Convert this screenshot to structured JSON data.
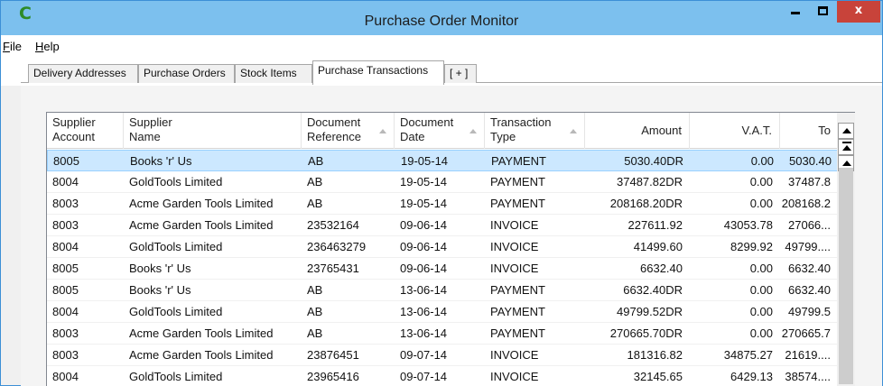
{
  "window": {
    "title": "Purchase Order Monitor",
    "app_icon": "C",
    "close_glyph": "x"
  },
  "menu": {
    "file": {
      "mnemonic": "F",
      "rest": "ile"
    },
    "help": {
      "mnemonic": "H",
      "rest": "elp"
    }
  },
  "tabs": [
    "Delivery Addresses",
    "Purchase Orders",
    "Stock Items",
    "Purchase Transactions",
    "[ + ]"
  ],
  "active_tab": "Purchase Transactions",
  "grid": {
    "columns": [
      {
        "line1": "Supplier",
        "line2": "Account"
      },
      {
        "line1": "Supplier",
        "line2": "Name"
      },
      {
        "line1": "Document",
        "line2": "Reference"
      },
      {
        "line1": "Document",
        "line2": "Date"
      },
      {
        "line1": "Transaction",
        "line2": "Type"
      },
      {
        "line1": "Amount",
        "line2": ""
      },
      {
        "line1": "V.A.T.",
        "line2": ""
      },
      {
        "line1": "To",
        "line2": ""
      }
    ],
    "rows": [
      [
        "8005",
        "Books 'r' Us",
        "AB",
        "19-05-14",
        "PAYMENT",
        "5030.40DR",
        "0.00",
        "5030.40"
      ],
      [
        "8004",
        "GoldTools Limited",
        "AB",
        "19-05-14",
        "PAYMENT",
        "37487.82DR",
        "0.00",
        "37487.8"
      ],
      [
        "8003",
        "Acme Garden Tools Limited",
        "AB",
        "19-05-14",
        "PAYMENT",
        "208168.20DR",
        "0.00",
        "208168.2"
      ],
      [
        "8003",
        "Acme Garden Tools Limited",
        "23532164",
        "09-06-14",
        "INVOICE",
        "227611.92",
        "43053.78",
        "27066..."
      ],
      [
        "8004",
        "GoldTools Limited",
        "236463279",
        "09-06-14",
        "INVOICE",
        "41499.60",
        "8299.92",
        "49799...."
      ],
      [
        "8005",
        "Books 'r' Us",
        "23765431",
        "09-06-14",
        "INVOICE",
        "6632.40",
        "0.00",
        "6632.40"
      ],
      [
        "8005",
        "Books 'r' Us",
        "AB",
        "13-06-14",
        "PAYMENT",
        "6632.40DR",
        "0.00",
        "6632.40"
      ],
      [
        "8004",
        "GoldTools Limited",
        "AB",
        "13-06-14",
        "PAYMENT",
        "49799.52DR",
        "0.00",
        "49799.5"
      ],
      [
        "8003",
        "Acme Garden Tools Limited",
        "AB",
        "13-06-14",
        "PAYMENT",
        "270665.70DR",
        "0.00",
        "270665.7"
      ],
      [
        "8003",
        "Acme Garden Tools Limited",
        "23876451",
        "09-07-14",
        "INVOICE",
        "181316.82",
        "34875.27",
        "21619...."
      ],
      [
        "8004",
        "GoldTools Limited",
        "23965416",
        "09-07-14",
        "INVOICE",
        "32145.65",
        "6429.13",
        "38574...."
      ]
    ],
    "selected_row": 0
  }
}
